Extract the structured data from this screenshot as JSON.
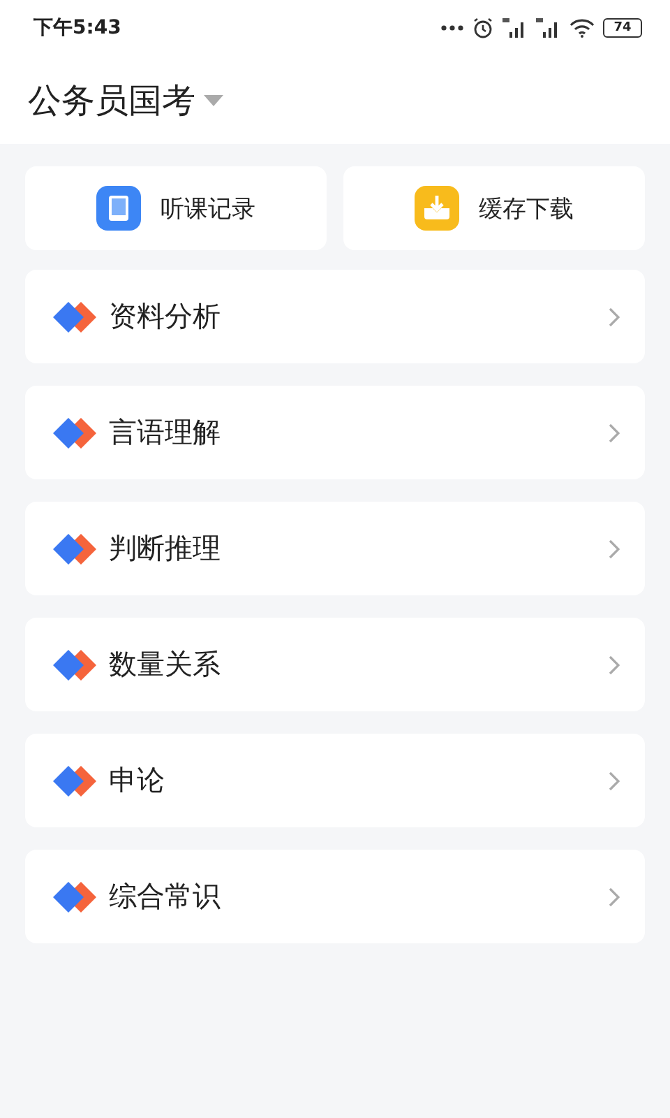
{
  "status_bar": {
    "time": "下午5:43",
    "battery": "74"
  },
  "header": {
    "title": "公务员国考"
  },
  "quick_actions": [
    {
      "kind": "history",
      "label": "听课记录"
    },
    {
      "kind": "download",
      "label": "缓存下载"
    }
  ],
  "subjects": [
    {
      "label": "资料分析"
    },
    {
      "label": "言语理解"
    },
    {
      "label": "判断推理"
    },
    {
      "label": "数量关系"
    },
    {
      "label": "申论"
    },
    {
      "label": "综合常识"
    }
  ]
}
